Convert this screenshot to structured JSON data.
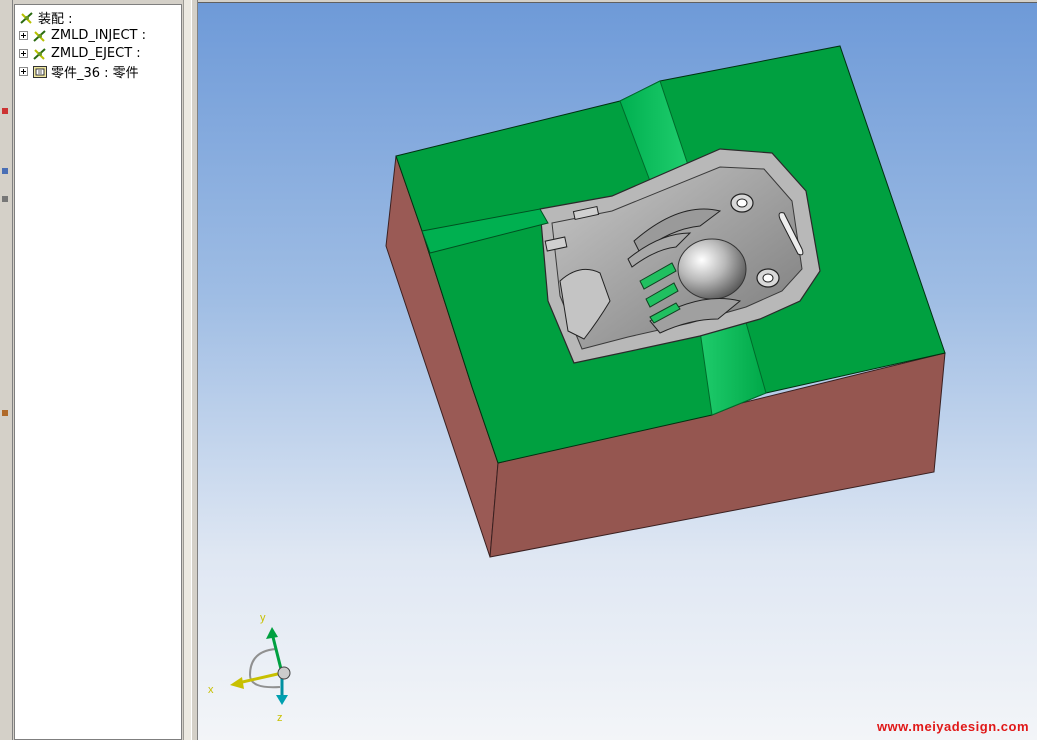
{
  "tree": {
    "root": {
      "label": "装配 :",
      "icon": "assembly-icon"
    },
    "items": [
      {
        "label": "ZMLD_INJECT :",
        "icon": "assembly-icon"
      },
      {
        "label": "ZMLD_EJECT :",
        "icon": "assembly-icon"
      },
      {
        "label": "零件_36 : 零件",
        "icon": "part-icon"
      }
    ]
  },
  "viewport": {
    "axes": {
      "x": "x",
      "y": "y",
      "z": "z"
    },
    "watermark": "www.meiyadesign.com"
  },
  "colors": {
    "mold_top": "#00a040",
    "mold_side": "#9a5a55",
    "cavity": "#9a9a9a",
    "watermark": "#e01818"
  }
}
